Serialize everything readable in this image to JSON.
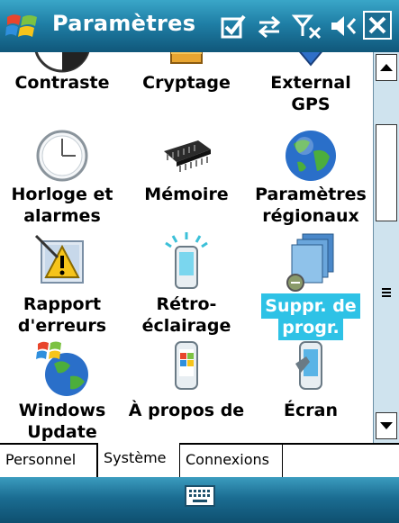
{
  "title": "Paramètres",
  "titlebar_icons": [
    "ok-check-icon",
    "connectivity-icon",
    "signal-off-icon",
    "volume-icon",
    "close-icon"
  ],
  "items": [
    {
      "label_line1": "Contraste",
      "label_line2": "",
      "icon": "contrast-icon"
    },
    {
      "label_line1": "Cryptage",
      "label_line2": "",
      "icon": "encryption-icon"
    },
    {
      "label_line1": "External",
      "label_line2": "GPS",
      "icon": "external-gps-icon"
    },
    {
      "label_line1": "Horloge et",
      "label_line2": "alarmes",
      "icon": "clock-icon"
    },
    {
      "label_line1": "Mémoire",
      "label_line2": "",
      "icon": "memory-chip-icon"
    },
    {
      "label_line1": "Paramètres",
      "label_line2": "régionaux",
      "icon": "globe-icon"
    },
    {
      "label_line1": "Rapport",
      "label_line2": "d'erreurs",
      "icon": "error-report-icon"
    },
    {
      "label_line1": "Rétro-",
      "label_line2": "éclairage",
      "icon": "backlight-icon"
    },
    {
      "label_line1": "Suppr. de",
      "label_line2": "progr.",
      "icon": "remove-programs-icon"
    },
    {
      "label_line1": "Windows",
      "label_line2": "Update",
      "icon": "windows-update-icon"
    },
    {
      "label_line1": "À propos de",
      "label_line2": "",
      "icon": "about-icon"
    },
    {
      "label_line1": "Écran",
      "label_line2": "",
      "icon": "screen-icon"
    }
  ],
  "selected_item": "Suppr. de progr.",
  "tabs": [
    {
      "label": "Personnel"
    },
    {
      "label": "Système"
    },
    {
      "label": "Connexions"
    }
  ],
  "active_tab": "Système",
  "colors": {
    "titlebar": "#1f7fa6",
    "selection": "#2ec2e6",
    "scrollbar": "#cfe3ee"
  }
}
